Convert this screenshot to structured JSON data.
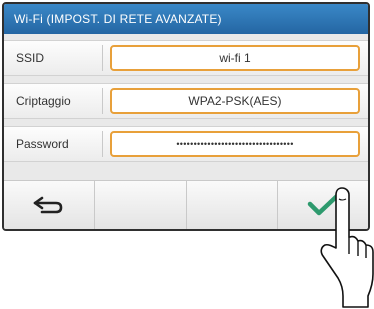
{
  "screen": {
    "title": "Wi-Fi (IMPOST. DI RETE AVANZATE)"
  },
  "rows": [
    {
      "label": "SSID",
      "value": "wi-fi 1"
    },
    {
      "label": "Criptaggio",
      "value": "WPA2-PSK(AES)"
    },
    {
      "label": "Password",
      "value": "••••••••••••••••••••••••••••••••••"
    }
  ],
  "bottom_bar": {
    "back_icon": "back-arrow-icon",
    "confirm_icon": "checkmark-icon",
    "accent_color": "#2e9a6e"
  },
  "colors": {
    "title_bar": "#2a72b0",
    "field_border": "#e8a03a"
  }
}
